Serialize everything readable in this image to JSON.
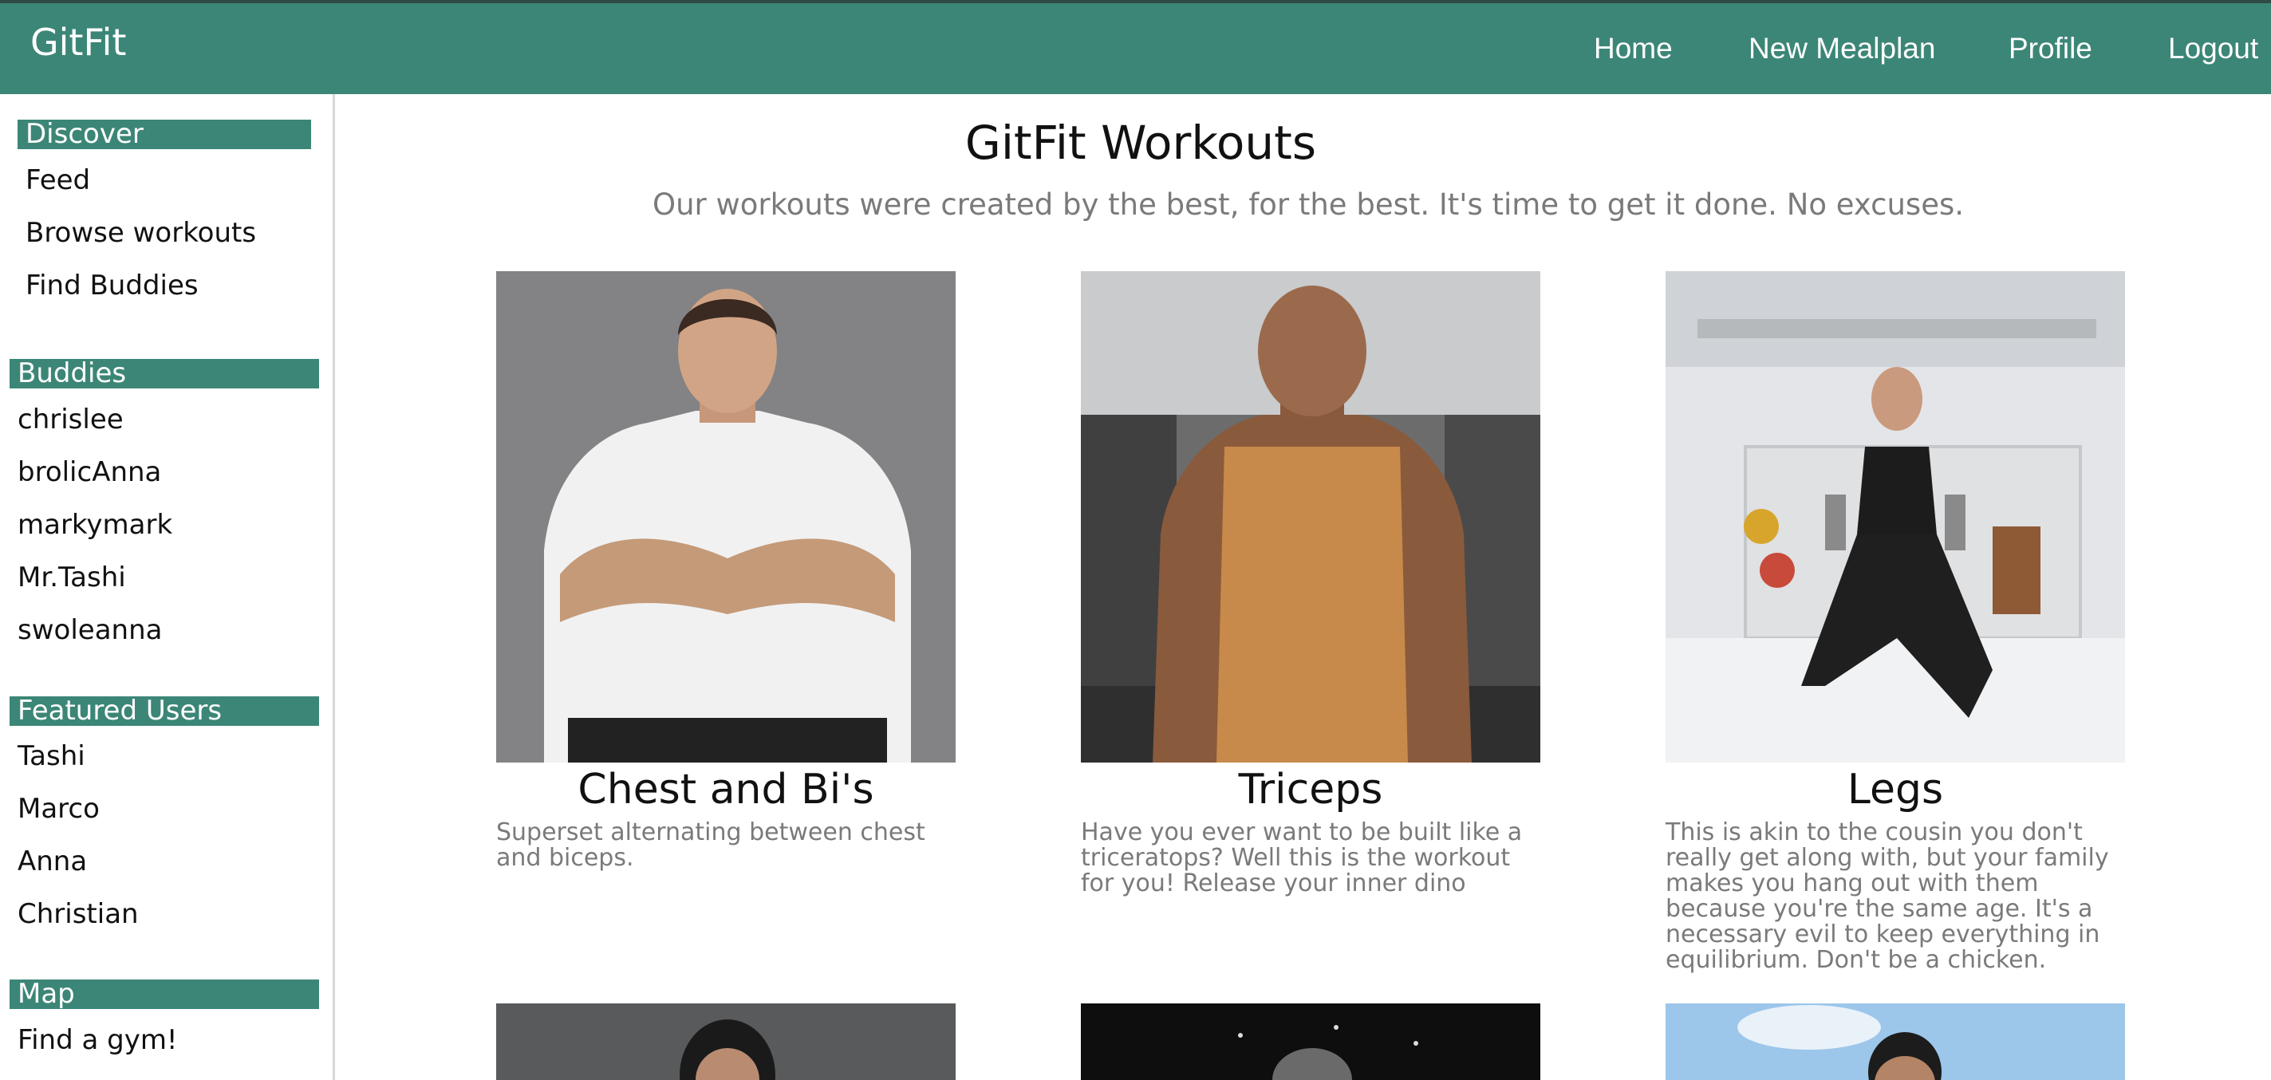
{
  "header": {
    "brand": "GitFit",
    "nav": [
      {
        "label": "Home"
      },
      {
        "label": "New Mealplan"
      },
      {
        "label": "Profile"
      },
      {
        "label": "Logout"
      }
    ],
    "color": "#3c8677"
  },
  "sidebar": {
    "discover": {
      "heading": "Discover",
      "items": [
        "Feed",
        "Browse workouts",
        "Find Buddies"
      ]
    },
    "buddies": {
      "heading": "Buddies",
      "items": [
        "chrislee",
        "brolicAnna",
        "markymark",
        "Mr.Tashi",
        "swoleanna"
      ]
    },
    "featured": {
      "heading": "Featured Users",
      "items": [
        "Tashi",
        "Marco",
        "Anna",
        "Christian"
      ]
    },
    "map": {
      "heading": "Map",
      "items": [
        "Find a gym!"
      ]
    }
  },
  "main": {
    "title": "GitFit Workouts",
    "subtitle": "Our workouts were created by the best, for the best. It's time to get it done. No excuses.",
    "workouts": [
      {
        "title": "Chest and Bi's",
        "description": "Superset alternating between chest and biceps."
      },
      {
        "title": "Triceps",
        "description": "Have you ever want to be built like a triceratops? Well this is the workout for you! Release your inner dino"
      },
      {
        "title": "Legs",
        "description": "This is akin to the cousin you don't really get along with, but your family makes you hang out with them because you're the same age. It's a necessary evil to keep everything in equilibrium. Don't be a chicken."
      }
    ]
  }
}
